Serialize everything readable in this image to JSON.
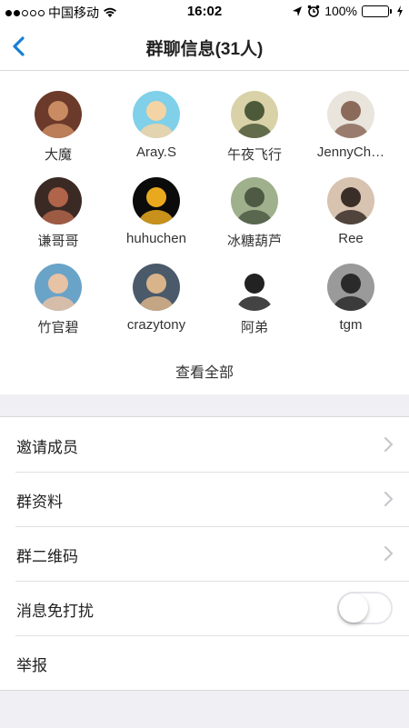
{
  "status_bar": {
    "carrier": "中国移动",
    "time": "16:02",
    "battery": "100%",
    "battery_level": 1.0,
    "icons": [
      "signal-icon",
      "wifi-icon",
      "location-arrow-icon",
      "alarm-icon",
      "battery-icon",
      "charging-icon"
    ]
  },
  "nav": {
    "title": "群聊信息(31人)",
    "back_icon": "chevron-left-icon",
    "accent": "#1a7ed4"
  },
  "members": [
    {
      "name": "大魔",
      "avatar_colors": [
        "#6b3a2a",
        "#c98b62"
      ]
    },
    {
      "name": "Aray.S",
      "avatar_colors": [
        "#7fd0e8",
        "#f4d4a4"
      ]
    },
    {
      "name": "午夜飞行",
      "avatar_colors": [
        "#d9d2a8",
        "#4c5a3a"
      ]
    },
    {
      "name": "JennyCh…",
      "avatar_colors": [
        "#e9e4dc",
        "#8c6a5a"
      ]
    },
    {
      "name": "谦哥哥",
      "avatar_colors": [
        "#3b2a24",
        "#b0644a"
      ]
    },
    {
      "name": "huhuchen",
      "avatar_colors": [
        "#0b0b0b",
        "#e9a91f"
      ]
    },
    {
      "name": "冰糖葫芦",
      "avatar_colors": [
        "#9fb08c",
        "#4e5a44"
      ]
    },
    {
      "name": "Ree",
      "avatar_colors": [
        "#d8c2b0",
        "#3a2e28"
      ]
    },
    {
      "name": "竹官碧",
      "avatar_colors": [
        "#6aa3c8",
        "#e8c2a4"
      ]
    },
    {
      "name": "crazytony",
      "avatar_colors": [
        "#4a5a6a",
        "#d9b48a"
      ]
    },
    {
      "name": "阿弟",
      "avatar_colors": [
        "#ffffff",
        "#222222"
      ]
    },
    {
      "name": "tgm",
      "avatar_colors": [
        "#9a9a9a",
        "#2a2a2a"
      ]
    }
  ],
  "view_all": "查看全部",
  "menu": [
    {
      "label": "邀请成员",
      "icon": "chevron-right-icon"
    },
    {
      "label": "群资料",
      "icon": "chevron-right-icon"
    },
    {
      "label": "群二维码",
      "icon": "chevron-right-icon"
    },
    {
      "label": "消息免打扰",
      "toggle": false
    },
    {
      "label": "举报"
    }
  ]
}
